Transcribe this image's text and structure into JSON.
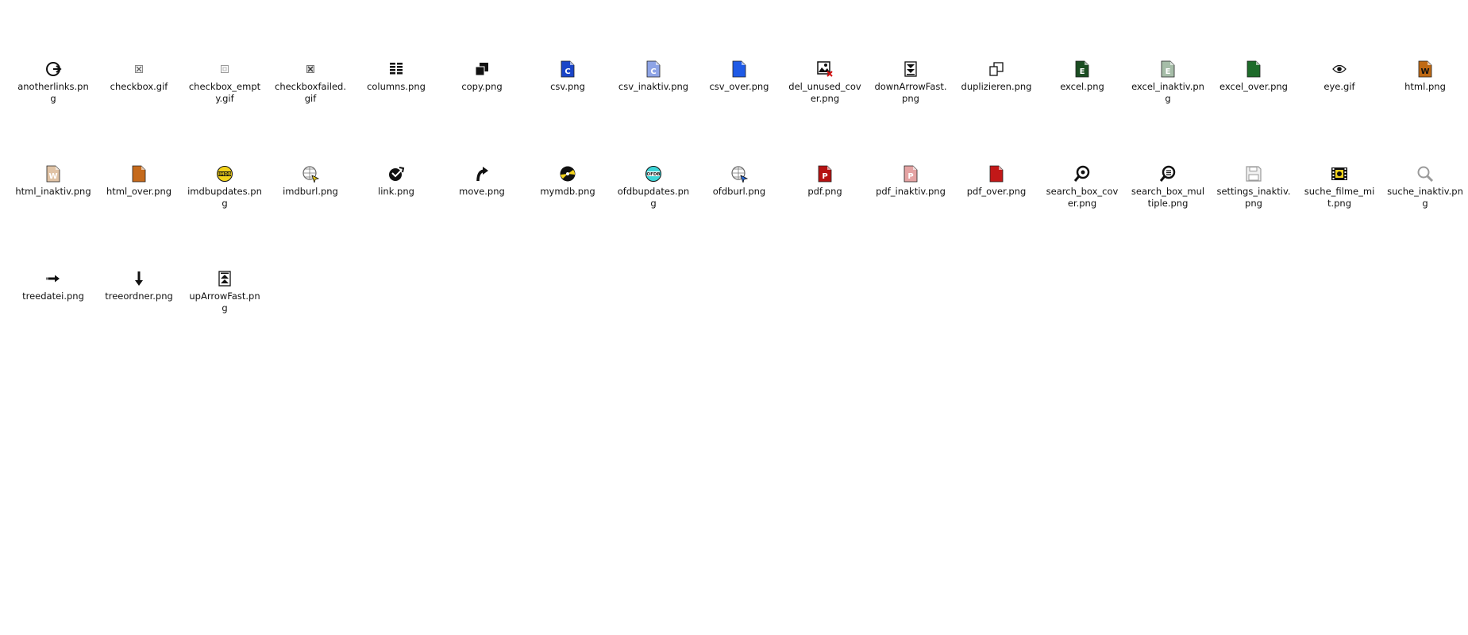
{
  "window": {
    "title": ""
  },
  "colors": {
    "label": "#111111",
    "background": "#ffffff"
  },
  "files": [
    {
      "name": "anotherlinks.png",
      "icon": "anotherlinks-icon"
    },
    {
      "name": "checkbox.gif",
      "icon": "checkbox-icon"
    },
    {
      "name": "checkbox_empty.gif",
      "icon": "checkbox-empty-icon"
    },
    {
      "name": "checkboxfailed.gif",
      "icon": "checkbox-failed-icon"
    },
    {
      "name": "columns.png",
      "icon": "columns-icon"
    },
    {
      "name": "copy.png",
      "icon": "copy-icon"
    },
    {
      "name": "csv.png",
      "icon": "csv-icon"
    },
    {
      "name": "csv_inaktiv.png",
      "icon": "csv-inactive-icon"
    },
    {
      "name": "csv_over.png",
      "icon": "csv-over-icon"
    },
    {
      "name": "del_unused_cover.png",
      "icon": "delete-cover-icon"
    },
    {
      "name": "downArrowFast.png",
      "icon": "down-arrow-fast-icon"
    },
    {
      "name": "duplizieren.png",
      "icon": "duplicate-icon"
    },
    {
      "name": "excel.png",
      "icon": "excel-icon"
    },
    {
      "name": "excel_inaktiv.png",
      "icon": "excel-inactive-icon"
    },
    {
      "name": "excel_over.png",
      "icon": "excel-over-icon"
    },
    {
      "name": "eye.gif",
      "icon": "eye-icon"
    },
    {
      "name": "html.png",
      "icon": "html-icon"
    },
    {
      "name": "html_inaktiv.png",
      "icon": "html-inactive-icon"
    },
    {
      "name": "html_over.png",
      "icon": "html-over-icon"
    },
    {
      "name": "imdbupdates.png",
      "icon": "imdb-updates-icon"
    },
    {
      "name": "imdburl.png",
      "icon": "imdb-url-icon"
    },
    {
      "name": "link.png",
      "icon": "link-icon"
    },
    {
      "name": "move.png",
      "icon": "move-icon"
    },
    {
      "name": "mymdb.png",
      "icon": "mymdb-icon"
    },
    {
      "name": "ofdbupdates.png",
      "icon": "ofdb-updates-icon"
    },
    {
      "name": "ofdburl.png",
      "icon": "ofdb-url-icon"
    },
    {
      "name": "pdf.png",
      "icon": "pdf-icon"
    },
    {
      "name": "pdf_inaktiv.png",
      "icon": "pdf-inactive-icon"
    },
    {
      "name": "pdf_over.png",
      "icon": "pdf-over-icon"
    },
    {
      "name": "search_box_cover.png",
      "icon": "search-cover-icon"
    },
    {
      "name": "search_box_multiple.png",
      "icon": "search-multiple-icon"
    },
    {
      "name": "settings_inaktiv.png",
      "icon": "save-inactive-icon"
    },
    {
      "name": "suche_filme_mit.png",
      "icon": "film-strip-icon"
    },
    {
      "name": "suche_inaktiv.png",
      "icon": "search-inactive-icon"
    },
    {
      "name": "treedatei.png",
      "icon": "arrow-right-icon"
    },
    {
      "name": "treeordner.png",
      "icon": "arrow-down-icon"
    },
    {
      "name": "upArrowFast.png",
      "icon": "up-arrow-fast-icon"
    }
  ]
}
